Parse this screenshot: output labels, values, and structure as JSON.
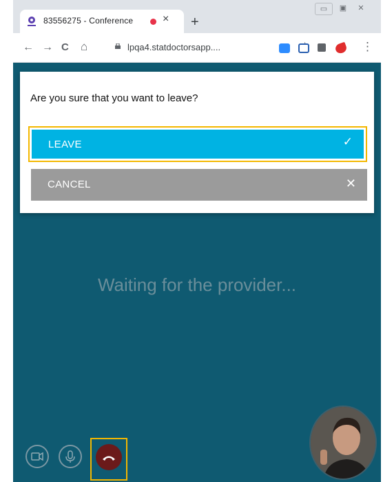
{
  "browser": {
    "tab_title": "83556275 - Conference",
    "tab_close": "×",
    "new_tab": "+",
    "url": "lpqa4.statdoctorsapp....",
    "nav": {
      "back": "←",
      "forward": "→",
      "reload": "C",
      "home": "⌂"
    },
    "star": "☆",
    "menu": "⋮",
    "window_controls": {
      "minimize": "▭",
      "maximize": "▣",
      "close": "✕"
    }
  },
  "dialog": {
    "question": "Are you sure that you want to leave?",
    "leave_label": "LEAVE",
    "leave_icon": "✓",
    "cancel_label": "CANCEL",
    "cancel_icon": "✕"
  },
  "main": {
    "waiting_text": "Waiting for the provider..."
  },
  "colors": {
    "background": "#0f5a71",
    "leave": "#00b3e3",
    "cancel": "#9b9b9b",
    "focus_outline": "#f3b700",
    "hangup": "#6b1a1a"
  },
  "icons": [
    "camera-icon",
    "microphone-icon",
    "phone-hangup-icon"
  ]
}
